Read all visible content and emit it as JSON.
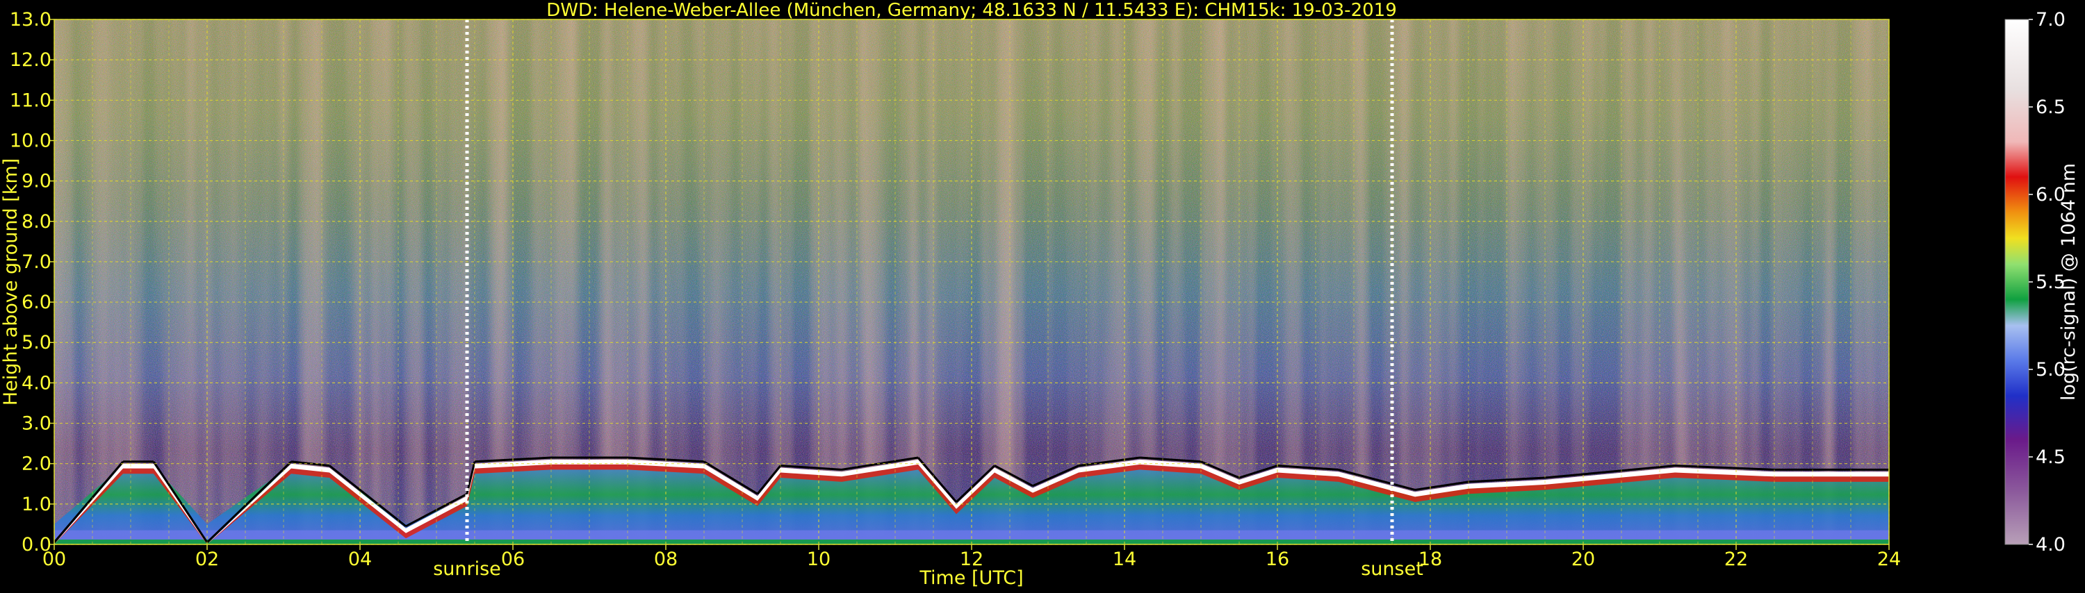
{
  "chart_data": {
    "type": "heatmap",
    "title": "DWD: Helene-Weber-Allee (München, Germany; 48.1633 N / 11.5433 E):    CHM15k: 19-03-2019",
    "xlabel": "Time [UTC]",
    "ylabel": "Height above ground [km]",
    "xlim": [
      0,
      24
    ],
    "ylim": [
      0,
      13
    ],
    "x_ticks": [
      "00",
      "02",
      "04",
      "06",
      "08",
      "10",
      "12",
      "14",
      "16",
      "18",
      "20",
      "22",
      "24"
    ],
    "y_ticks": [
      "0.0",
      "1.0",
      "2.0",
      "3.0",
      "4.0",
      "5.0",
      "6.0",
      "7.0",
      "8.0",
      "9.0",
      "10.0",
      "11.0",
      "12.0",
      "13.0"
    ],
    "grid": true,
    "colorbar": {
      "label": "log(rc-signal) @ 1064 nm",
      "range": [
        4.0,
        7.0
      ],
      "ticks": [
        "4.0",
        "4.5",
        "5.0",
        "5.5",
        "6.0",
        "6.5",
        "7.0"
      ],
      "stops": [
        {
          "v": 4.0,
          "c": "#b8a0b8"
        },
        {
          "v": 4.3,
          "c": "#8c5a9c"
        },
        {
          "v": 4.6,
          "c": "#6a1a8a"
        },
        {
          "v": 4.85,
          "c": "#2030c8"
        },
        {
          "v": 5.05,
          "c": "#5a7ae8"
        },
        {
          "v": 5.25,
          "c": "#a8c0f0"
        },
        {
          "v": 5.4,
          "c": "#10a040"
        },
        {
          "v": 5.6,
          "c": "#90e070"
        },
        {
          "v": 5.75,
          "c": "#f0e020"
        },
        {
          "v": 5.9,
          "c": "#f09010"
        },
        {
          "v": 6.1,
          "c": "#e01010"
        },
        {
          "v": 6.3,
          "c": "#f0b8b8"
        },
        {
          "v": 6.6,
          "c": "#e8e0e0"
        },
        {
          "v": 7.0,
          "c": "#ffffff"
        }
      ]
    },
    "annotations": [
      {
        "x": 5.4,
        "label": "sunrise"
      },
      {
        "x": 17.5,
        "label": "sunset"
      }
    ],
    "cloud_base_km": [
      [
        0.0,
        0.0
      ],
      [
        0.9,
        2.0
      ],
      [
        1.3,
        2.0
      ],
      [
        2.0,
        0.0
      ],
      [
        3.1,
        2.0
      ],
      [
        3.6,
        1.9
      ],
      [
        4.6,
        0.4
      ],
      [
        5.4,
        1.2
      ],
      [
        5.5,
        2.0
      ],
      [
        6.5,
        2.1
      ],
      [
        7.5,
        2.1
      ],
      [
        8.5,
        2.0
      ],
      [
        9.2,
        1.2
      ],
      [
        9.5,
        1.9
      ],
      [
        10.3,
        1.8
      ],
      [
        11.3,
        2.1
      ],
      [
        11.8,
        1.0
      ],
      [
        12.3,
        1.9
      ],
      [
        12.8,
        1.4
      ],
      [
        13.4,
        1.9
      ],
      [
        14.2,
        2.1
      ],
      [
        15.0,
        2.0
      ],
      [
        15.5,
        1.6
      ],
      [
        16.0,
        1.9
      ],
      [
        16.8,
        1.8
      ],
      [
        17.8,
        1.3
      ],
      [
        18.5,
        1.5
      ],
      [
        19.5,
        1.6
      ],
      [
        21.2,
        1.9
      ],
      [
        22.5,
        1.8
      ],
      [
        24.0,
        1.8
      ]
    ],
    "colors": {
      "text": "#ffff33",
      "grid": "#e6dc28",
      "white_text": "#ffffff"
    }
  }
}
